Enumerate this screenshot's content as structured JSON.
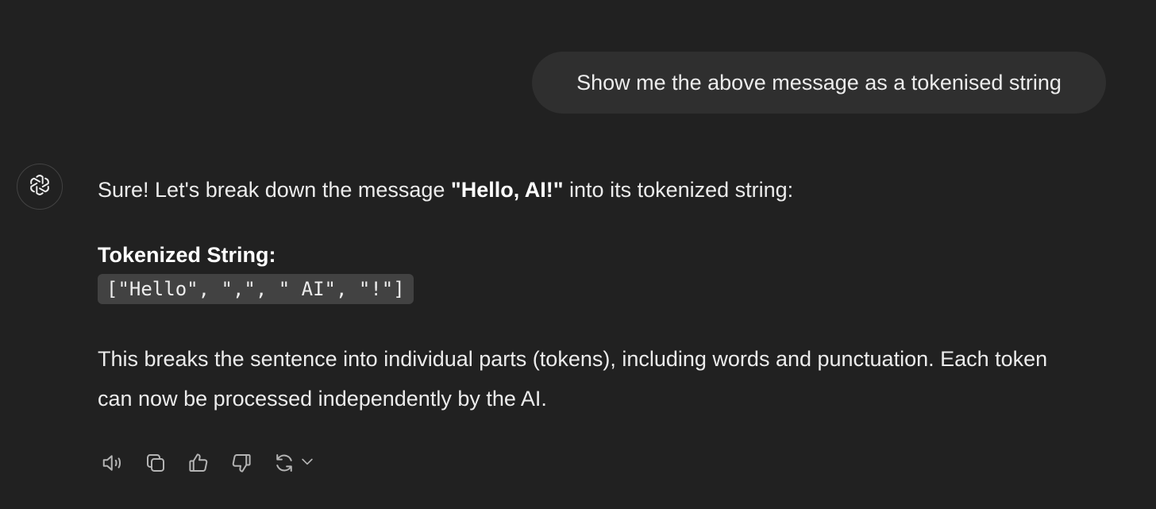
{
  "user_message": {
    "text": "Show me the above message as a tokenised string"
  },
  "assistant_message": {
    "avatar_icon": "openai-logo-icon",
    "intro_before": "Sure! Let's break down the message ",
    "intro_bold": "\"Hello, AI!\"",
    "intro_after": " into its tokenized string:",
    "heading": "Tokenized String:",
    "code": "[\"Hello\", \",\", \" AI\", \"!\"]",
    "paragraph": "This breaks the sentence into individual parts (tokens), including words and punctuation. Each token can now be processed independently by the AI."
  },
  "actions": [
    {
      "icon": "speaker-icon"
    },
    {
      "icon": "copy-icon"
    },
    {
      "icon": "thumbs-up-icon"
    },
    {
      "icon": "thumbs-down-icon"
    },
    {
      "icon": "regenerate-icon"
    },
    {
      "icon": "chevron-down-icon"
    }
  ],
  "colors": {
    "background": "#212121",
    "user_bubble": "#2f2f2f",
    "code_background": "#424242",
    "text": "#ececec",
    "icon": "#b4b4b4"
  }
}
